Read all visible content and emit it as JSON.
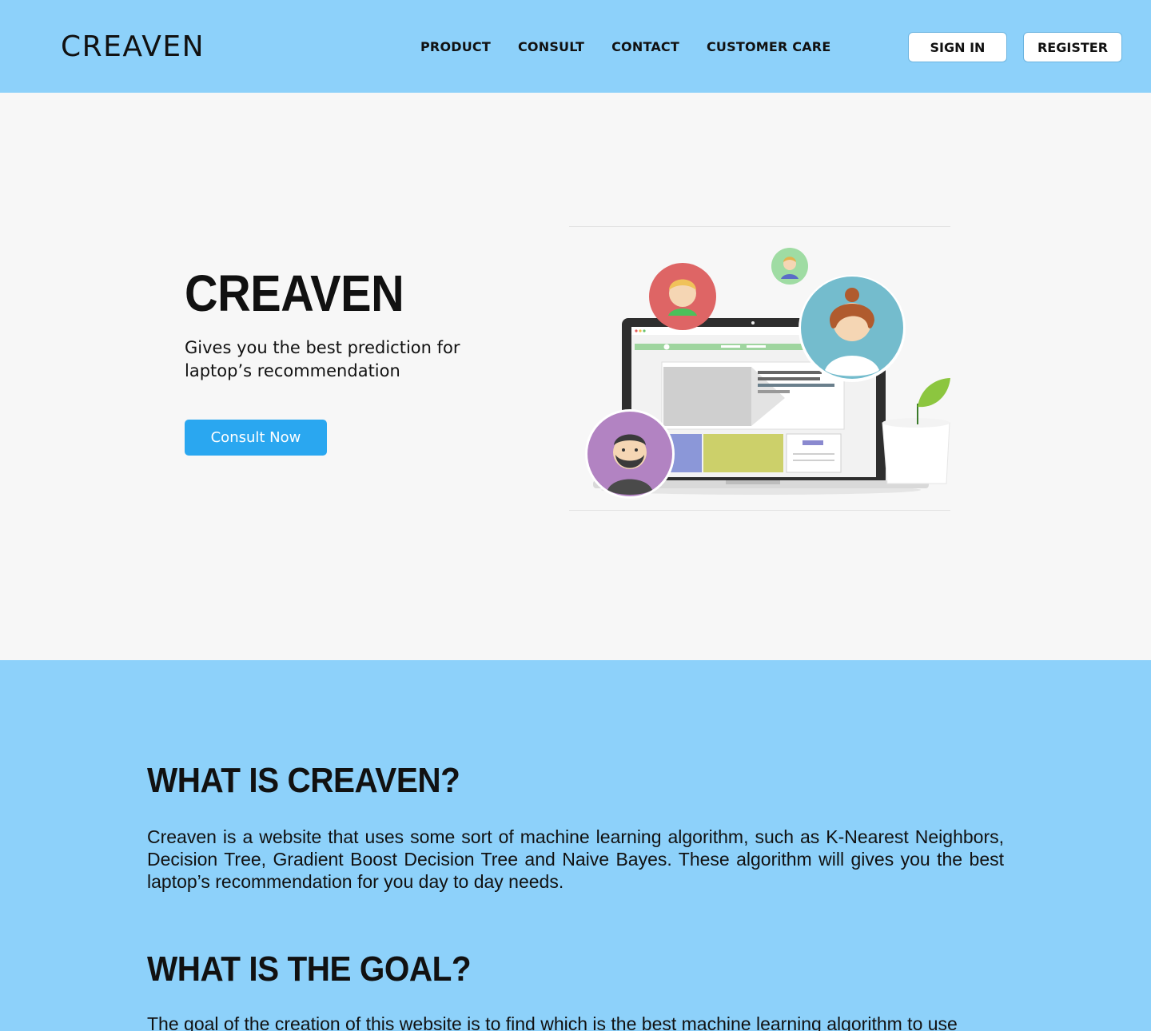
{
  "navbar": {
    "brand": "CREAVEN",
    "links": [
      "PRODUCT",
      "CONSULT",
      "CONTACT",
      "CUSTOMER CARE"
    ],
    "signin_label": "SIGN IN",
    "register_label": "REGISTER"
  },
  "hero": {
    "title": "CREAVEN",
    "subtitle": "Gives you the best prediction for laptop’s recommendation",
    "cta_label": "Consult Now"
  },
  "about": {
    "what_title": "WHAT IS CREAVEN?",
    "what_body": "Creaven is a website that uses some sort of machine learning algorithm, such as K-Nearest Neighbors, Decision Tree, Gradient Boost Decision Tree and Naive Bayes. These algorithm will gives you the best laptop’s recommendation for you day to day needs.",
    "goal_title": "WHAT IS THE GOAL?",
    "goal_body": "The goal of the creation of this website is to find which is the best machine learning algorithm to use"
  },
  "colors": {
    "nav_bg": "#8dd1fa",
    "hero_bg": "#f7f7f7",
    "cta_bg": "#2aa7f0"
  }
}
